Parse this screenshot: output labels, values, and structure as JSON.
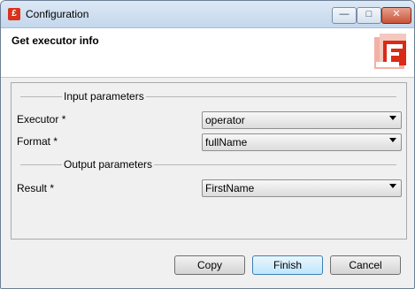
{
  "window": {
    "title": "Configuration",
    "app_icon": "app-logo-icon",
    "controls": {
      "minimize": "minimize-icon",
      "maximize": "maximize-icon",
      "close": "close-icon"
    }
  },
  "header": {
    "title": "Get executor info",
    "logo": "executor-logo-icon"
  },
  "input_group": {
    "title": "Input parameters",
    "fields": [
      {
        "label": "Executor *",
        "value": "operator"
      },
      {
        "label": "Format *",
        "value": "fullName"
      }
    ]
  },
  "output_group": {
    "title": "Output parameters",
    "fields": [
      {
        "label": "Result *",
        "value": "FirstName"
      }
    ]
  },
  "buttons": {
    "copy": "Copy",
    "finish": "Finish",
    "cancel": "Cancel"
  }
}
